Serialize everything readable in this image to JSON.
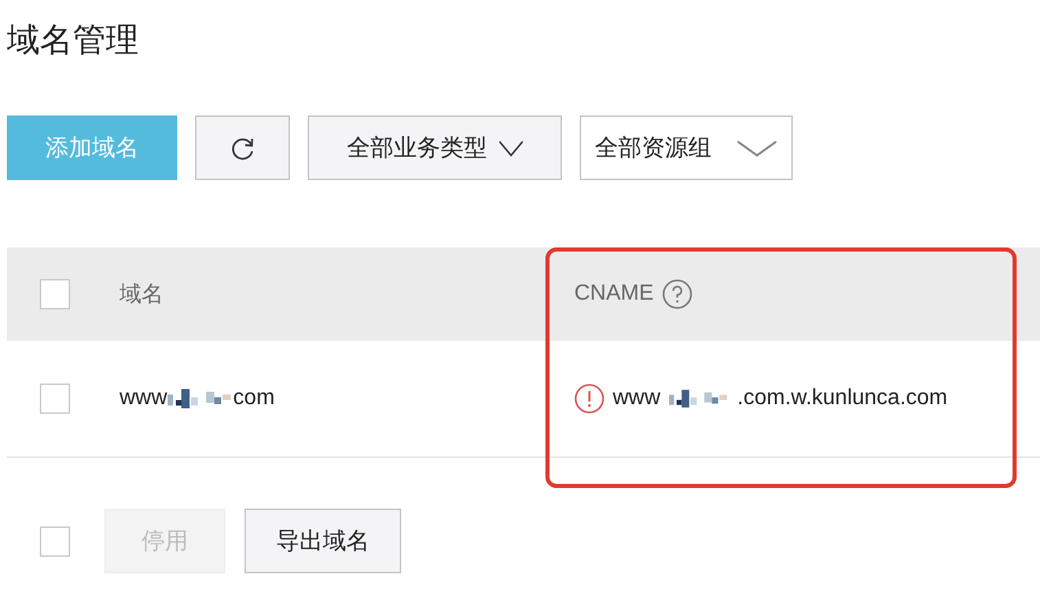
{
  "page_title": "域名管理",
  "toolbar": {
    "add_button": "添加域名",
    "filters": [
      {
        "label": "全部业务类型",
        "kind": "tight"
      },
      {
        "label": "全部资源组",
        "kind": "wide"
      }
    ]
  },
  "table": {
    "select_all_checked": false,
    "columns": [
      {
        "label": "域名",
        "help": false
      },
      {
        "label": "CNAME",
        "help": true
      }
    ],
    "rows": [
      {
        "checked": false,
        "domain": {
          "prefix": "www",
          "suffix": "com"
        },
        "cname": {
          "warning": true,
          "prefix": "www",
          "suffix": ".com.w.kunlunca.com"
        }
      }
    ]
  },
  "footer": {
    "checked": false,
    "buttons": [
      {
        "label": "停用",
        "disabled": true
      },
      {
        "label": "导出域名",
        "disabled": false
      }
    ]
  },
  "highlight": true
}
